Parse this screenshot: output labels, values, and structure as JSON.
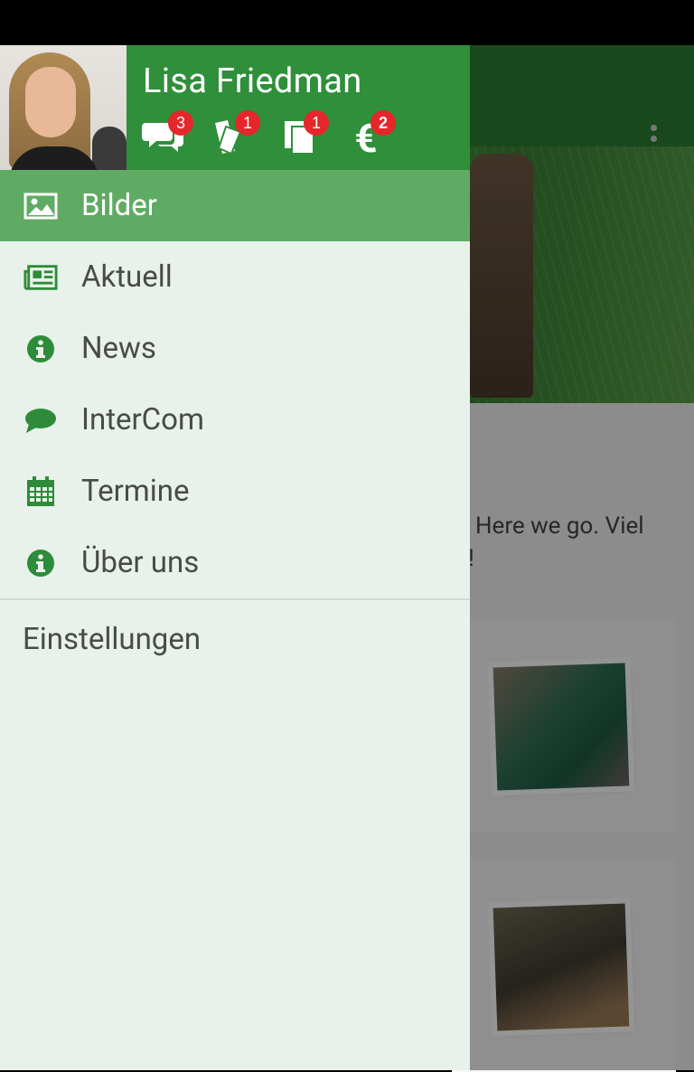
{
  "user": {
    "name": "Lisa Friedman"
  },
  "badges": [
    {
      "icon": "chat-bubbles-icon",
      "count": "3"
    },
    {
      "icon": "tickets-icon",
      "count": "1"
    },
    {
      "icon": "documents-icon",
      "count": "1"
    },
    {
      "icon": "euro-icon",
      "count": "2"
    }
  ],
  "menu": {
    "items": [
      {
        "label": "Bilder",
        "icon": "image-icon",
        "active": true
      },
      {
        "label": "Aktuell",
        "icon": "newspaper-icon"
      },
      {
        "label": "News",
        "icon": "info-icon"
      },
      {
        "label": "InterCom",
        "icon": "chat-icon"
      },
      {
        "label": "Termine",
        "icon": "calendar-icon"
      },
      {
        "label": "Über uns",
        "icon": "info-icon"
      }
    ],
    "settings_label": "Einstellungen"
  },
  "background": {
    "post_text_line1": "Here we go. Viel",
    "post_text_line2": "en!"
  },
  "colors": {
    "header_green": "#2f8f3a",
    "active_item": "#60ab64",
    "drawer_bg": "#e8f2ea",
    "badge_red": "#e5262b"
  }
}
